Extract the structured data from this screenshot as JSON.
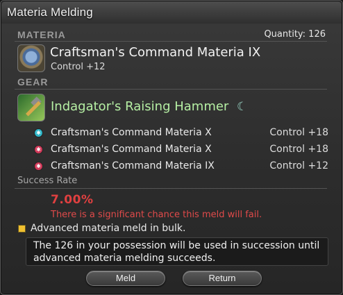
{
  "window": {
    "title": "Materia Melding"
  },
  "materia_section": {
    "label": "MATERIA",
    "quantity": "Quantity: 126",
    "item_name": "Craftsman's Command Materia IX",
    "item_stat": "Control +12",
    "icon": "materia-orb-icon"
  },
  "gear_section": {
    "label": "GEAR",
    "item_name": "Indagator's Raising Hammer",
    "hq_symbol": "☾",
    "icon": "hammer-icon",
    "slots": [
      {
        "name": "Craftsman's Command Materia X",
        "stat": "Control +18",
        "color": "#2fb7c9",
        "glyph": "✱"
      },
      {
        "name": "Craftsman's Command Materia X",
        "stat": "Control +18",
        "color": "#d13a5a",
        "glyph": "✱"
      },
      {
        "name": "Craftsman's Command Materia IX",
        "stat": "Control +12",
        "color": "#d13a5a",
        "glyph": "✱"
      }
    ]
  },
  "success": {
    "label": "Success Rate",
    "rate": "7.00%",
    "warning": "There is a significant chance this meld will fail."
  },
  "bulk": {
    "label": "Advanced materia meld in bulk.",
    "checked": true,
    "info": "The 126 in your possession will be used in succession until advanced materia melding succeeds."
  },
  "buttons": {
    "meld": "Meld",
    "return": "Return"
  },
  "colors": {
    "warning_red": "#e04040",
    "hq_green": "#b6f0a4",
    "checkbox_yellow": "#f0c030"
  }
}
